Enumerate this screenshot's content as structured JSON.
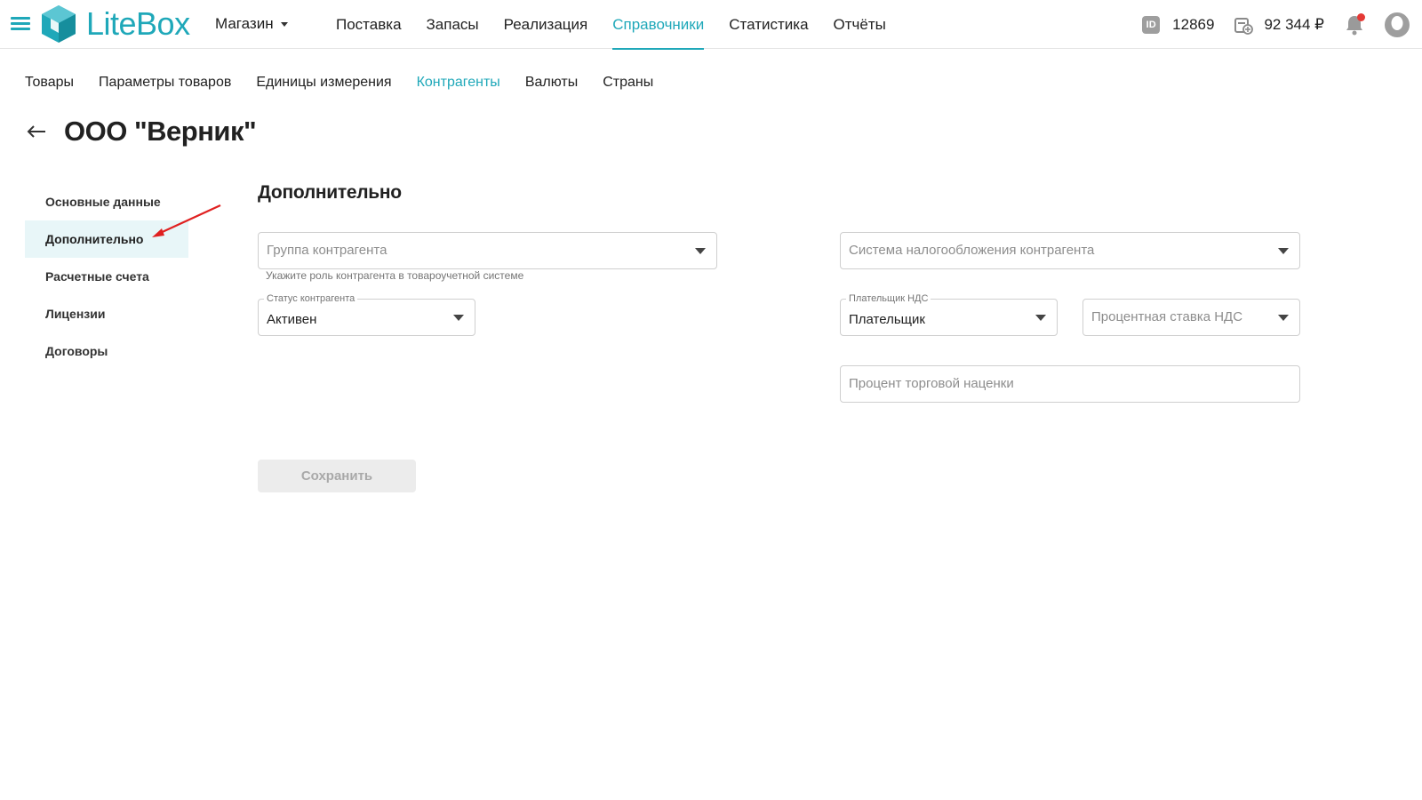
{
  "header": {
    "logo_text": "LiteBox",
    "store_select": "Магазин",
    "nav": [
      {
        "label": "Поставка",
        "active": false
      },
      {
        "label": "Запасы",
        "active": false
      },
      {
        "label": "Реализация",
        "active": false
      },
      {
        "label": "Справочники",
        "active": true
      },
      {
        "label": "Статистика",
        "active": false
      },
      {
        "label": "Отчёты",
        "active": false
      }
    ],
    "id_badge": "ID",
    "account_id": "12869",
    "balance": "92 344 ₽",
    "accent_color": "#1fa8b9",
    "notification_dot_color": "#e53935"
  },
  "sub_nav": [
    {
      "label": "Товары",
      "active": false
    },
    {
      "label": "Параметры товаров",
      "active": false
    },
    {
      "label": "Единицы измерения",
      "active": false
    },
    {
      "label": "Контрагенты",
      "active": true
    },
    {
      "label": "Валюты",
      "active": false
    },
    {
      "label": "Страны",
      "active": false
    }
  ],
  "page": {
    "title": "ООО \"Верник\""
  },
  "section_menu": [
    {
      "label": "Основные данные",
      "active": false
    },
    {
      "label": "Дополнительно",
      "active": true
    },
    {
      "label": "Расчетные счета",
      "active": false
    },
    {
      "label": "Лицензии",
      "active": false
    },
    {
      "label": "Договоры",
      "active": false
    }
  ],
  "form": {
    "heading": "Дополнительно",
    "group": {
      "placeholder": "Группа контрагента",
      "helper": "Укажите роль контрагента в товароучетной системе"
    },
    "status": {
      "label": "Статус контрагента",
      "value": "Активен"
    },
    "tax_system": {
      "placeholder": "Система налогообложения контрагента"
    },
    "vat_payer": {
      "label": "Плательщик НДС",
      "value": "Плательщик"
    },
    "vat_rate": {
      "placeholder": "Процентная ставка НДС"
    },
    "markup": {
      "placeholder": "Процент торговой наценки"
    },
    "save_label": "Сохранить"
  }
}
